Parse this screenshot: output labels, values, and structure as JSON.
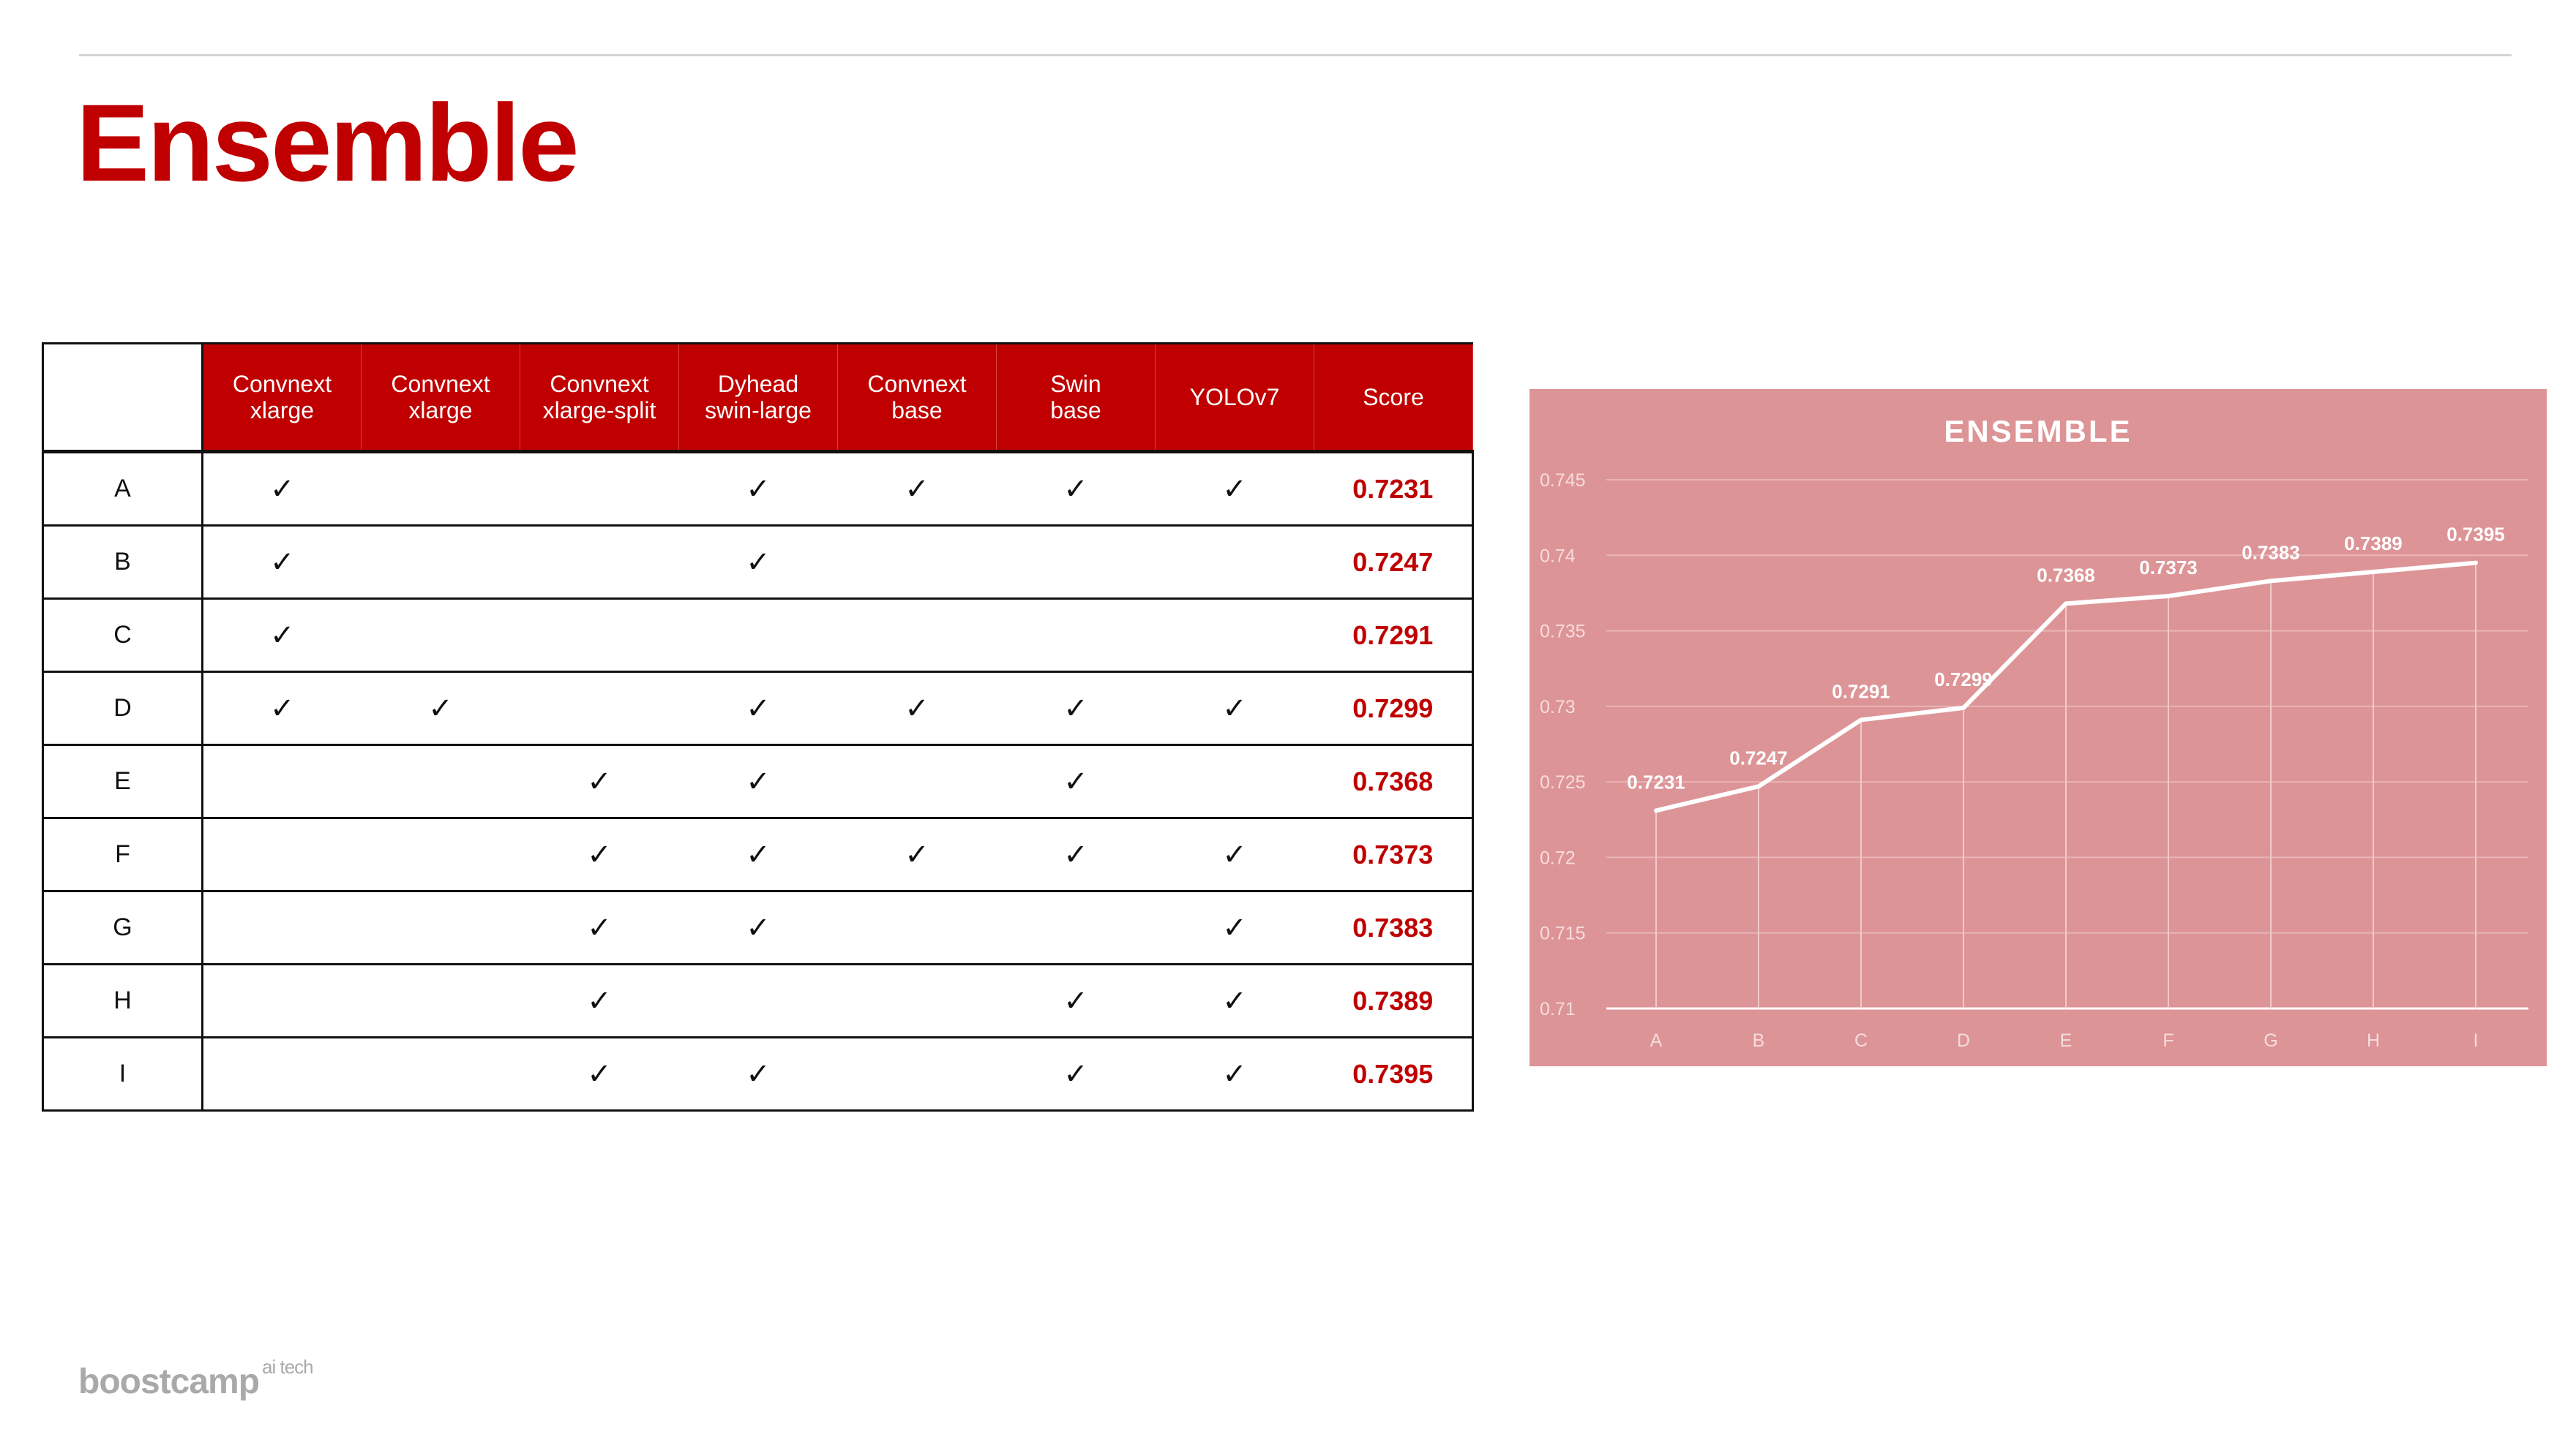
{
  "page": {
    "title": "Ensemble",
    "logo_main": "boostcamp",
    "logo_sup": "ai tech",
    "accent_color": "#c00000"
  },
  "table": {
    "columns": [
      [
        "Convnext",
        "xlarge"
      ],
      [
        "Convnext",
        "xlarge"
      ],
      [
        "Convnext",
        "xlarge-split"
      ],
      [
        "Dyhead",
        "swin-large"
      ],
      [
        "Convnext",
        "base"
      ],
      [
        "Swin",
        "base"
      ],
      [
        "YOLOv7"
      ],
      [
        "Score"
      ]
    ],
    "check_symbol": "✓",
    "rows": [
      {
        "label": "A",
        "checks": [
          true,
          false,
          false,
          true,
          true,
          true,
          true
        ],
        "score": "0.7231"
      },
      {
        "label": "B",
        "checks": [
          true,
          false,
          false,
          true,
          false,
          false,
          false
        ],
        "score": "0.7247"
      },
      {
        "label": "C",
        "checks": [
          true,
          false,
          false,
          false,
          false,
          false,
          false
        ],
        "score": "0.7291"
      },
      {
        "label": "D",
        "checks": [
          true,
          true,
          false,
          true,
          true,
          true,
          true
        ],
        "score": "0.7299"
      },
      {
        "label": "E",
        "checks": [
          false,
          false,
          true,
          true,
          false,
          true,
          false
        ],
        "score": "0.7368"
      },
      {
        "label": "F",
        "checks": [
          false,
          false,
          true,
          true,
          true,
          true,
          true
        ],
        "score": "0.7373"
      },
      {
        "label": "G",
        "checks": [
          false,
          false,
          true,
          true,
          false,
          false,
          true
        ],
        "score": "0.7383"
      },
      {
        "label": "H",
        "checks": [
          false,
          false,
          true,
          false,
          false,
          true,
          true
        ],
        "score": "0.7389"
      },
      {
        "label": "I",
        "checks": [
          false,
          false,
          true,
          true,
          false,
          true,
          true
        ],
        "score": "0.7395"
      }
    ]
  },
  "chart_data": {
    "type": "line",
    "title": "ENSEMBLE",
    "categories": [
      "A",
      "B",
      "C",
      "D",
      "E",
      "F",
      "G",
      "H",
      "I"
    ],
    "values": [
      0.7231,
      0.7247,
      0.7291,
      0.7299,
      0.7368,
      0.7373,
      0.7383,
      0.7389,
      0.7395
    ],
    "data_labels": [
      "0.7231",
      "0.7247",
      "0.7291",
      "0.7299",
      "0.7368",
      "0.7373",
      "0.7383",
      "0.7389",
      "0.7395"
    ],
    "yticks": [
      0.71,
      0.715,
      0.72,
      0.725,
      0.73,
      0.735,
      0.74,
      0.745
    ],
    "ytick_labels": [
      "0.71",
      "0.715",
      "0.72",
      "0.725",
      "0.73",
      "0.735",
      "0.74",
      "0.745"
    ],
    "ylim": [
      0.71,
      0.745
    ],
    "xlabel": "",
    "ylabel": "",
    "grid": true,
    "drop_lines": true,
    "background_color": "#dd9497",
    "line_color": "#ffffff"
  }
}
